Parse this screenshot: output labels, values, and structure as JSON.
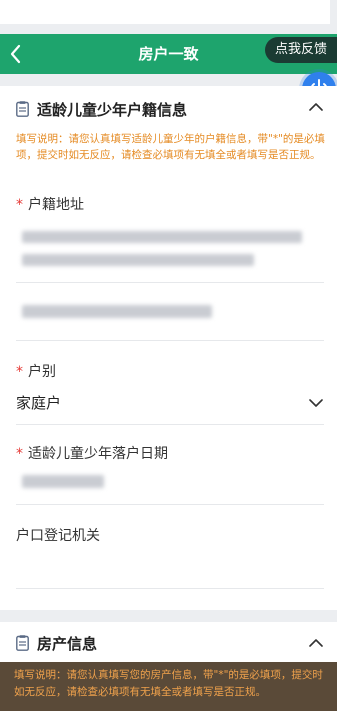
{
  "header": {
    "back_icon": "chevron-left-icon",
    "title": "房户一致",
    "feedback_label": "点我反馈"
  },
  "floating": {
    "power_icon": "power-icon",
    "color": "#2f80ed"
  },
  "section1": {
    "title": "适龄儿童少年户籍信息",
    "notice": "填写说明：请您认真填写适龄儿童少年的户籍信息，带\"*\"的是必填项，提交时如无反应，请检查必填项有无填全或者填写是否正规。",
    "fields": {
      "address": {
        "required_mark": "*",
        "label": "户籍地址"
      },
      "household_type": {
        "required_mark": "*",
        "label": "户别",
        "value": "家庭户"
      },
      "settle_date": {
        "required_mark": "*",
        "label": "适龄儿童少年落户日期"
      },
      "authority": {
        "label": "户口登记机关"
      }
    }
  },
  "section2": {
    "title": "房产信息",
    "notice": "填写说明：请您认真填写您的房产信息，带\"*\"的是必填项，提交时如无反应，请检查必填项有无填全或者填写是否正规。"
  },
  "colors": {
    "header_bg": "#1ea46d",
    "notice_text": "#e58b24",
    "required": "#e53935"
  }
}
